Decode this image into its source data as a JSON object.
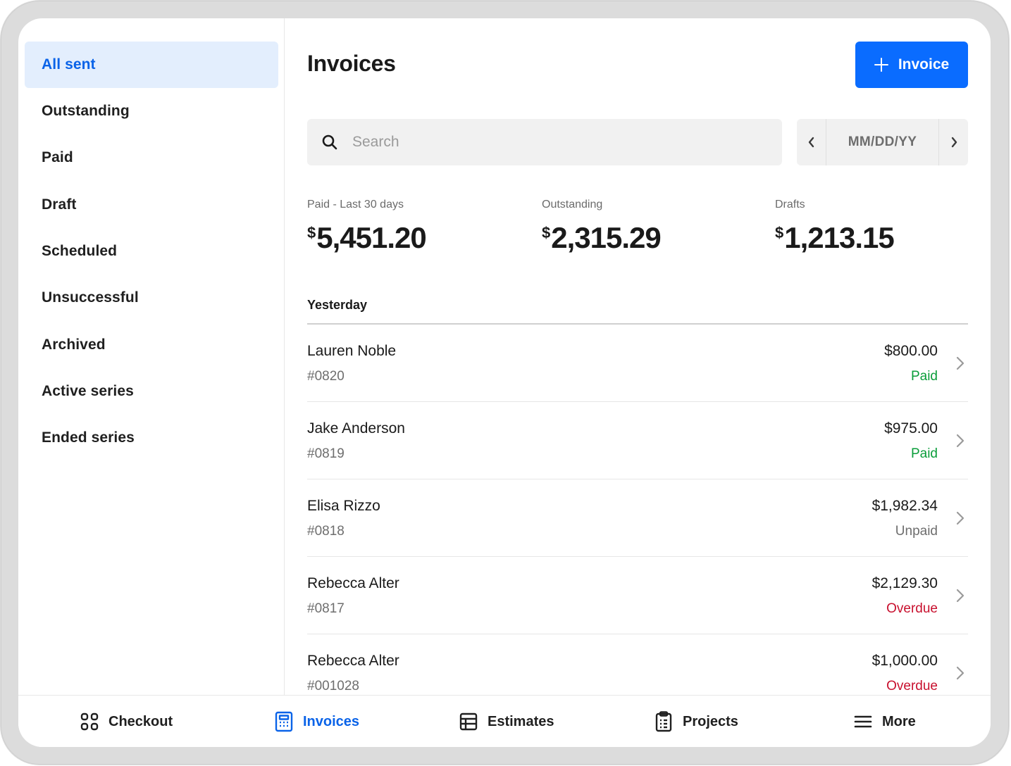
{
  "sidebar": {
    "items": [
      {
        "label": "All sent"
      },
      {
        "label": "Outstanding"
      },
      {
        "label": "Paid"
      },
      {
        "label": "Draft"
      },
      {
        "label": "Scheduled"
      },
      {
        "label": "Unsuccessful"
      },
      {
        "label": "Archived"
      },
      {
        "label": "Active series"
      },
      {
        "label": "Ended series"
      }
    ],
    "active_index": 0
  },
  "header": {
    "title": "Invoices",
    "new_button_label": "Invoice"
  },
  "search": {
    "placeholder": "Search",
    "value": ""
  },
  "date_filter": {
    "label": "MM/DD/YY"
  },
  "stats": [
    {
      "label": "Paid - Last 30 days",
      "currency": "$",
      "amount": "5,451.20"
    },
    {
      "label": "Outstanding",
      "currency": "$",
      "amount": "2,315.29"
    },
    {
      "label": "Drafts",
      "currency": "$",
      "amount": "1,213.15"
    }
  ],
  "group": {
    "title": "Yesterday"
  },
  "invoices": [
    {
      "name": "Lauren Noble",
      "number": "#0820",
      "amount": "$800.00",
      "status": "Paid",
      "status_color": "#0a9d3a"
    },
    {
      "name": "Jake Anderson",
      "number": "#0819",
      "amount": "$975.00",
      "status": "Paid",
      "status_color": "#0a9d3a"
    },
    {
      "name": "Elisa Rizzo",
      "number": "#0818",
      "amount": "$1,982.34",
      "status": "Unpaid",
      "status_color": "#6e6e6e"
    },
    {
      "name": "Rebecca Alter",
      "number": "#0817",
      "amount": "$2,129.30",
      "status": "Overdue",
      "status_color": "#c8102e"
    },
    {
      "name": "Rebecca Alter",
      "number": "#001028",
      "amount": "$1,000.00",
      "status": "Overdue",
      "status_color": "#c8102e"
    }
  ],
  "bottom_nav": {
    "items": [
      {
        "label": "Checkout",
        "icon": "grid-icon"
      },
      {
        "label": "Invoices",
        "icon": "invoice-icon"
      },
      {
        "label": "Estimates",
        "icon": "table-icon"
      },
      {
        "label": "Projects",
        "icon": "clipboard-icon"
      },
      {
        "label": "More",
        "icon": "menu-icon"
      }
    ],
    "active_index": 1
  },
  "colors": {
    "accent": "#0a6cff",
    "active_nav_bg": "#e3eefd",
    "active_text": "#0a63e8",
    "paid": "#0a9d3a",
    "overdue": "#c8102e",
    "unpaid": "#6e6e6e"
  }
}
